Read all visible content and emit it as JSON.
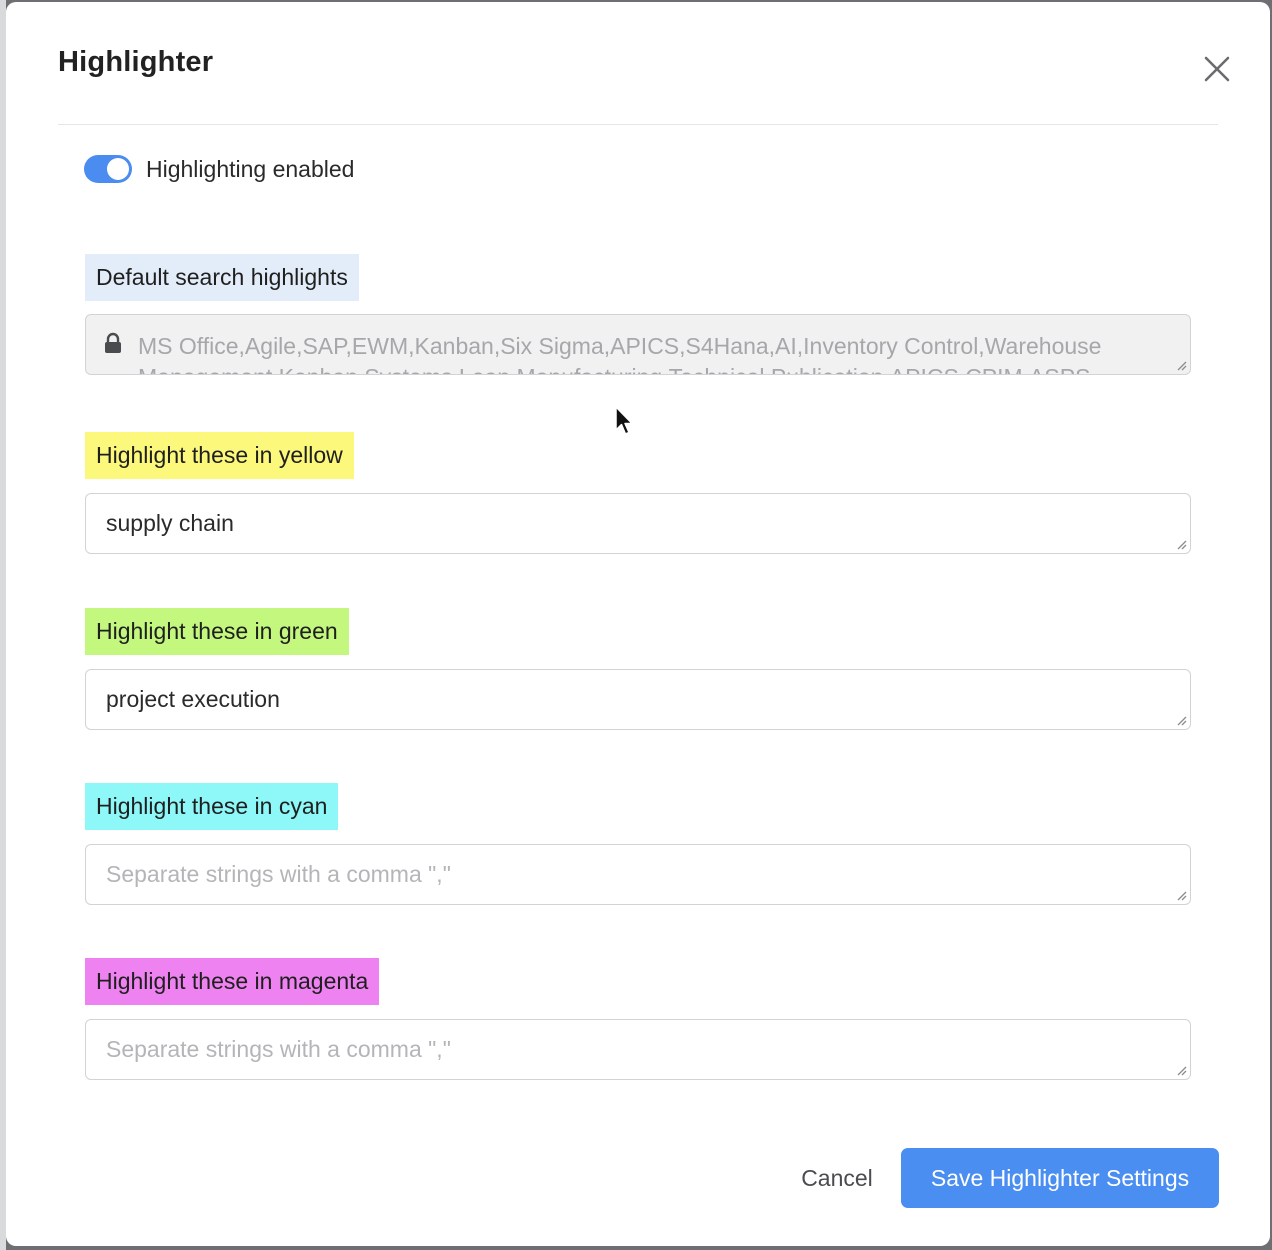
{
  "dialog": {
    "title": "Highlighter",
    "close_icon": "close-icon"
  },
  "toggle": {
    "label": "Highlighting enabled",
    "enabled": true,
    "accent_color": "#4a8cf0"
  },
  "default_highlights": {
    "label": "Default search highlights",
    "label_color": "#e3edfa",
    "value": "MS Office,Agile,SAP,EWM,Kanban,Six Sigma,APICS,S4Hana,AI,Inventory Control,Warehouse Management,Kanban Systems,Lean Manufacturing,Technical Publication,APICS,CPIM,ASPS",
    "locked": true,
    "icon": "lock-icon"
  },
  "yellow": {
    "label": "Highlight these in yellow",
    "label_color": "#fbf87b",
    "value": "supply chain",
    "placeholder": ""
  },
  "green": {
    "label": "Highlight these in green",
    "label_color": "#c3f77d",
    "value": "project execution",
    "placeholder": ""
  },
  "cyan": {
    "label": "Highlight these in cyan",
    "label_color": "#8ef7f7",
    "value": "",
    "placeholder": "Separate strings with a comma \",\""
  },
  "magenta": {
    "label": "Highlight these in magenta",
    "label_color": "#ee82f0",
    "value": "",
    "placeholder": "Separate strings with a comma \",\""
  },
  "footer": {
    "cancel_label": "Cancel",
    "save_label": "Save Highlighter Settings",
    "save_color": "#4a8ef2"
  }
}
